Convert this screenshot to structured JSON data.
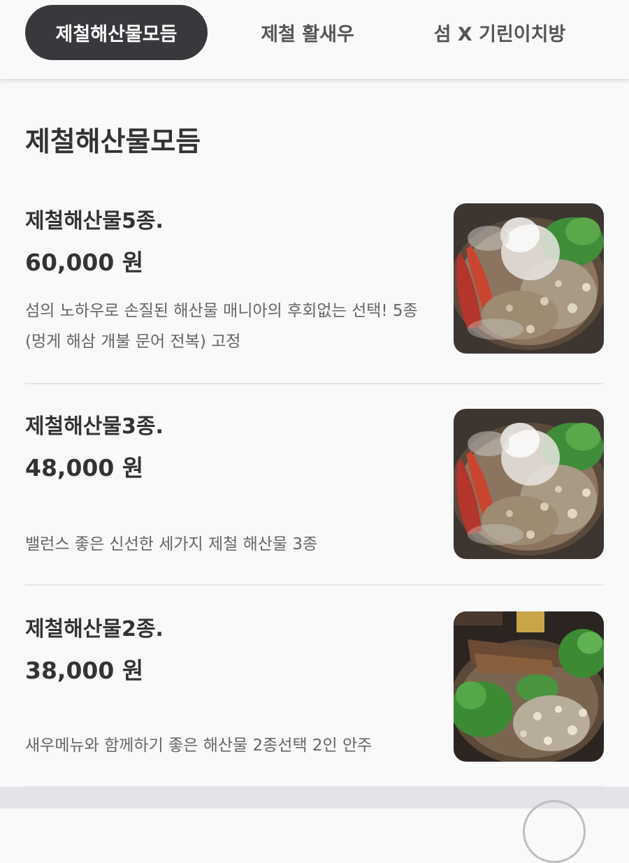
{
  "tabs": [
    {
      "label": "제철해산물모듬",
      "active": true
    },
    {
      "label": "제철 활새우",
      "active": false
    },
    {
      "label": "섬 X 기린이치방",
      "active": false
    }
  ],
  "section": {
    "title": "제철해산물모듬"
  },
  "menu_items": [
    {
      "name": "제철해산물5종.",
      "price": "60,000 원",
      "description": "섬의 노하우로 손질된 해산물 매니아의 후회없는 선택! 5종(멍게 해삼 개불 문어 전복) 고정",
      "image": "seafood-platter-smoke-photo"
    },
    {
      "name": "제철해산물3종.",
      "price": "48,000 원",
      "description": "밸런스 좋은 신선한 세가지 제철 해산물 3종",
      "image": "seafood-platter-smoke-photo"
    },
    {
      "name": "제철해산물2종.",
      "price": "38,000 원",
      "description": "새우메뉴와 함께하기 좋은 해산물 2종선택 2인 안주",
      "image": "seafood-platter-greens-photo"
    }
  ],
  "colors": {
    "active_tab_bg": "#38383d",
    "background": "#f9f9fa",
    "text": "#333333",
    "muted_text": "#666666"
  }
}
